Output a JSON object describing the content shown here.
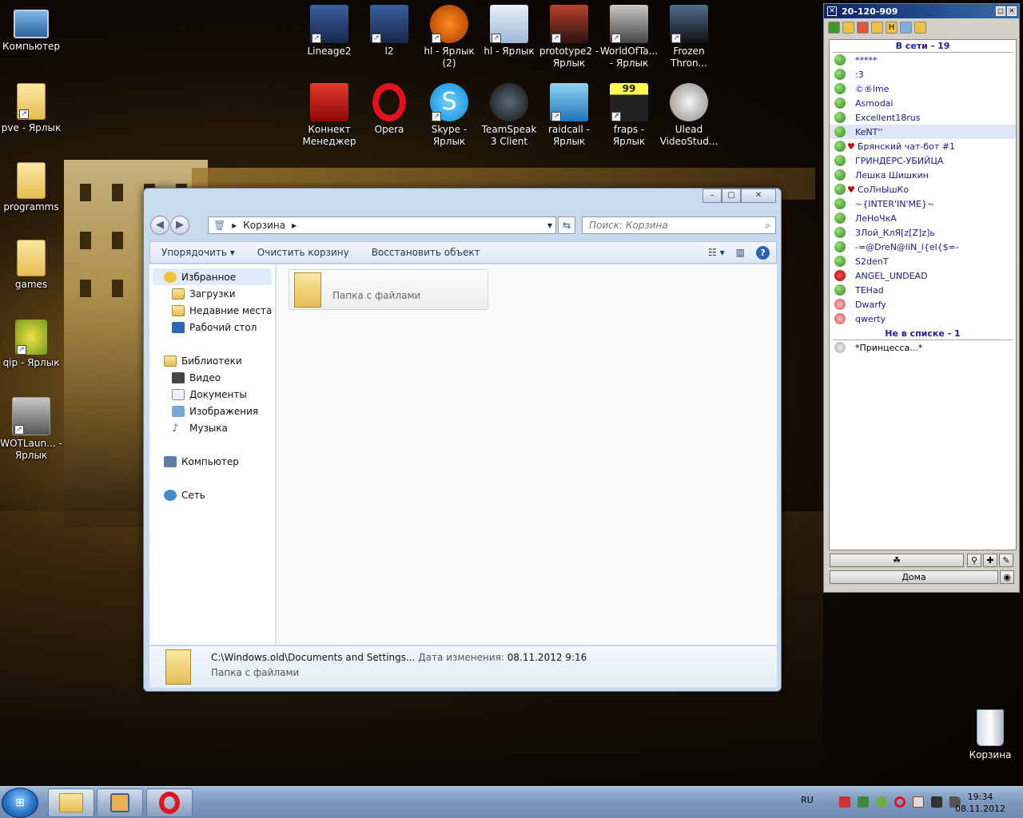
{
  "desktop_icons": [
    {
      "label": "Компьютер",
      "icon": "computer-icon"
    },
    {
      "label": "pve - Ярлык",
      "icon": "folder-icon"
    },
    {
      "label": "programms",
      "icon": "folder-icon"
    },
    {
      "label": "games",
      "icon": "folder-icon"
    },
    {
      "label": "qip - Ярлык",
      "icon": "qip-icon"
    },
    {
      "label": "WOTLaun... - Ярлык",
      "icon": "wot-icon"
    },
    {
      "label": "Lineage2",
      "icon": "lineage-icon"
    },
    {
      "label": "l2",
      "icon": "lineage-icon"
    },
    {
      "label": "hl - Ярлык (2)",
      "icon": "half-life-icon"
    },
    {
      "label": "hl - Ярлык",
      "icon": "settings-icon"
    },
    {
      "label": "prototype2 - Ярлык",
      "icon": "prototype-icon"
    },
    {
      "label": "WorldOfTa... - Ярлык",
      "icon": "wot-icon"
    },
    {
      "label": "Frozen Thron...",
      "icon": "warcraft-icon"
    },
    {
      "label": "Коннект Менеджер",
      "icon": "connect-icon"
    },
    {
      "label": "Opera",
      "icon": "opera-icon"
    },
    {
      "label": "Skype - Ярлык",
      "icon": "skype-icon"
    },
    {
      "label": "TeamSpeak 3 Client",
      "icon": "teamspeak-icon"
    },
    {
      "label": "raidcall - Ярлык",
      "icon": "raidcall-icon"
    },
    {
      "label": "fraps - Ярлык",
      "icon": "fraps-icon"
    },
    {
      "label": "Ulead VideoStud...",
      "icon": "ulead-icon"
    },
    {
      "label": "Корзина",
      "icon": "recycle-bin-icon"
    }
  ],
  "explorer": {
    "address": "Корзина",
    "search_placeholder": "Поиск: Корзина",
    "toolbar": {
      "organize": "Упорядочить",
      "empty": "Очистить корзину",
      "restore": "Восстановить объект"
    },
    "nav": {
      "favorites": "Избранное",
      "fav_items": [
        "Загрузки",
        "Недавние места",
        "Рабочий стол"
      ],
      "libraries": "Библиотеки",
      "lib_items": [
        "Видео",
        "Документы",
        "Изображения",
        "Музыка"
      ],
      "computer": "Компьютер",
      "network": "Сеть"
    },
    "item": {
      "type": "Папка с файлами"
    },
    "details": {
      "path": "C:\\Windows.old\\Documents and Settings...",
      "modified_label": "Дата изменения:",
      "modified_value": "08.11.2012 9:16",
      "type": "Папка с файлами"
    }
  },
  "qip": {
    "title": "20-120-909",
    "online_group": "В сети - 19",
    "contacts": [
      "*****",
      ":3",
      "©®ime",
      "Asmodai",
      "Excellent18rus",
      "KeNT''",
      "Брянский чат-бот #1",
      "ГРИНДЕРС-УБИЙЦА",
      "Лешка Шишкин",
      "СоЛнЫшКо",
      "~{INTER'IN'ME}~",
      "ЛеНоЧкА",
      "3Лой_КлЯ[z[Z]z]ь",
      "-=@DreN@liN_l{el{$=-",
      "S2denT",
      "ANGEL_UNDEAD",
      "TEHad",
      "Dwarfy",
      "qwerty"
    ],
    "offlist_group": "Не в списке - 1",
    "offlist": [
      "*Принцесса...*"
    ],
    "status": "Дома"
  },
  "taskbar": {
    "lang": "RU",
    "time": "19:34",
    "date": "08.11.2012"
  }
}
